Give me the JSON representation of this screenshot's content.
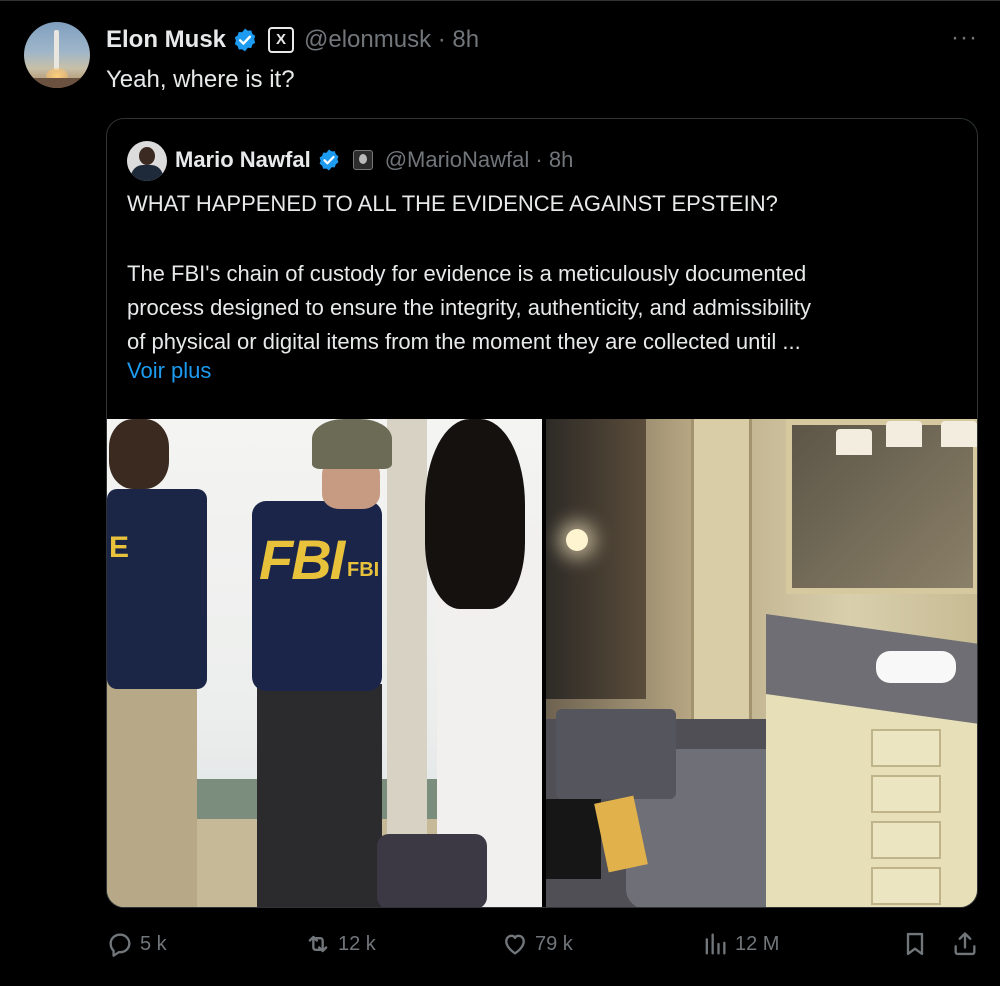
{
  "tweet": {
    "author_name": "Elon Musk",
    "handle_time": "@elonmusk · 8h",
    "badge_label": "X",
    "text": "Yeah, where is it?",
    "more_label": "···"
  },
  "quote": {
    "author_name": "Mario Nawfal",
    "handle_time": "@MarioNawfal · 8h",
    "title": "WHAT HAPPENED TO ALL THE EVIDENCE AGAINST EPSTEIN?",
    "body_lines": [
      "The FBI's chain of custody for evidence is a meticulously documented",
      "process designed to ensure the integrity, authenticity, and admissibility",
      "of physical or digital items from the moment they are collected until ..."
    ],
    "see_more": "Voir plus",
    "images": {
      "left_fbi_big": "FBI",
      "left_fbi_small": "FBI",
      "left_e": "E"
    }
  },
  "actions": {
    "replies": "5 k",
    "reposts": "12 k",
    "likes": "79 k",
    "views": "12 M"
  },
  "icons": [
    "verified-icon",
    "x-badge-icon",
    "more-icon",
    "reply-icon",
    "repost-icon",
    "like-icon",
    "views-icon",
    "bookmark-icon",
    "share-icon"
  ],
  "colors": {
    "background": "#000000",
    "text": "#e7e9ea",
    "muted": "#71767b",
    "link": "#1d9bf0",
    "verified": "#1d9bf0",
    "border": "#2f3336"
  }
}
